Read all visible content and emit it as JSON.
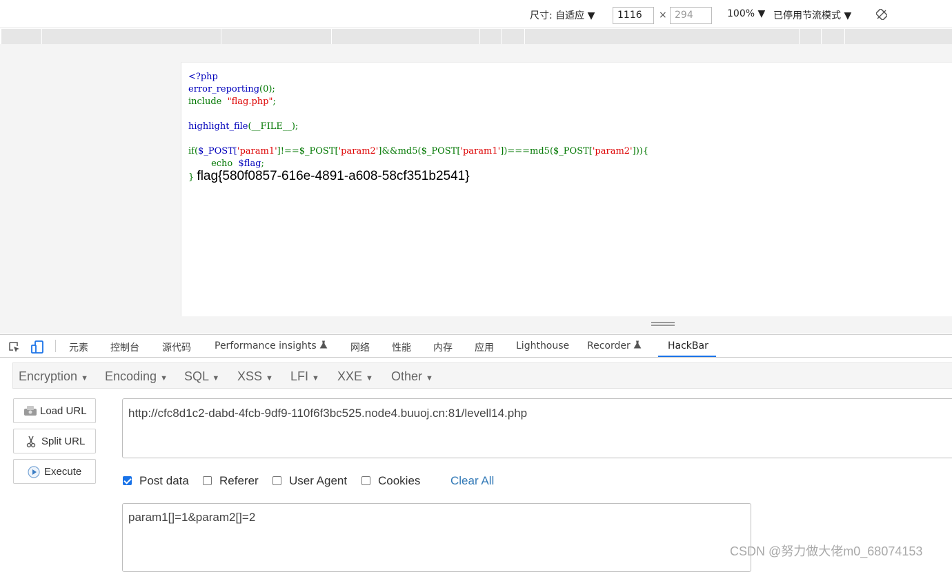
{
  "device_toolbar": {
    "size_label": "尺寸: 自适应 ▼",
    "width_value": "1116",
    "height_placeholder": "294",
    "times": "×",
    "zoom": "100% ▼",
    "throttle": "已停用节流模式 ▼"
  },
  "page_code": {
    "line1": "<?php",
    "line2_fn": "error_reporting",
    "line2_rest": "(0);",
    "line3_kw": "include",
    "line3_str": "\"flag.php\"",
    "line3_end": ";",
    "line5_fn": "highlight_file",
    "line5_rest": "(__FILE__);",
    "line7": {
      "if": "if(",
      "post1": "$_POST[",
      "p1": "'param1'",
      "neq": "]!==$_POST[",
      "p2": "'param2'",
      "and": "]&&md5($_POST[",
      "p3": "'param1'",
      "eq": "])===md5($_POST[",
      "p4": "'param2'",
      "end": "])){"
    },
    "line8_kw": "echo",
    "line8_var": "$flag",
    "line8_end": ";",
    "line9_brace": "}",
    "flag": "flag{580f0857-616e-4891-a608-58cf351b2541}"
  },
  "devtools_tabs": [
    {
      "label": "元素"
    },
    {
      "label": "控制台"
    },
    {
      "label": "源代码"
    },
    {
      "label": "Performance insights"
    },
    {
      "label": "网络"
    },
    {
      "label": "性能"
    },
    {
      "label": "内存"
    },
    {
      "label": "应用"
    },
    {
      "label": "Lighthouse"
    },
    {
      "label": "Recorder"
    },
    {
      "label": "HackBar"
    }
  ],
  "hackbar": {
    "menu": [
      "Encryption",
      "Encoding",
      "SQL",
      "XSS",
      "LFI",
      "XXE",
      "Other"
    ],
    "buttons": {
      "load_url": "Load URL",
      "split_url": "Split URL",
      "execute": "Execute"
    },
    "url": "http://cfc8d1c2-dabd-4fcb-9df9-110f6f3bc525.node4.buuoj.cn:81/levell14.php",
    "options": {
      "post_data": "Post data",
      "referer": "Referer",
      "user_agent": "User Agent",
      "cookies": "Cookies",
      "clear_all": "Clear All"
    },
    "post_body": "param1[]=1&param2[]=2"
  },
  "watermark": "CSDN @努力做大佬m0_68074153"
}
